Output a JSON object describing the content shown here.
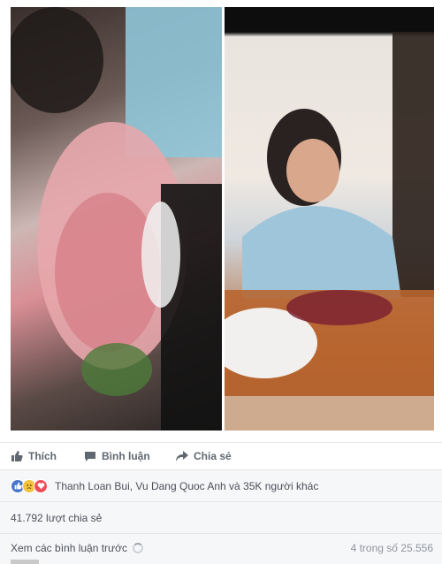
{
  "post": {
    "photos": [
      {
        "alt_icon": "photo-left"
      },
      {
        "alt_icon": "photo-right"
      }
    ]
  },
  "actions": {
    "like_label": "Thích",
    "comment_label": "Bình luận",
    "share_label": "Chia sẻ",
    "like_icon": "thumbs-up-icon",
    "comment_icon": "comment-icon",
    "share_icon": "share-arrow-icon"
  },
  "reactions": {
    "icons": [
      "like-reaction-icon",
      "sad-reaction-icon",
      "love-reaction-icon"
    ],
    "text": "Thanh Loan Bui, Vu Dang Quoc Anh và 35K người khác"
  },
  "shares": {
    "text": "41.792 lượt chia sẻ"
  },
  "comments": {
    "previous_label": "Xem các bình luận trước",
    "count_text": "4 trong số 25.556"
  },
  "colors": {
    "like_blue": "#4a76c9",
    "sad_yellow": "#f2c33c",
    "love_red": "#ed4d57",
    "muted_text": "#606770",
    "panel_bg": "#f6f7f9"
  }
}
